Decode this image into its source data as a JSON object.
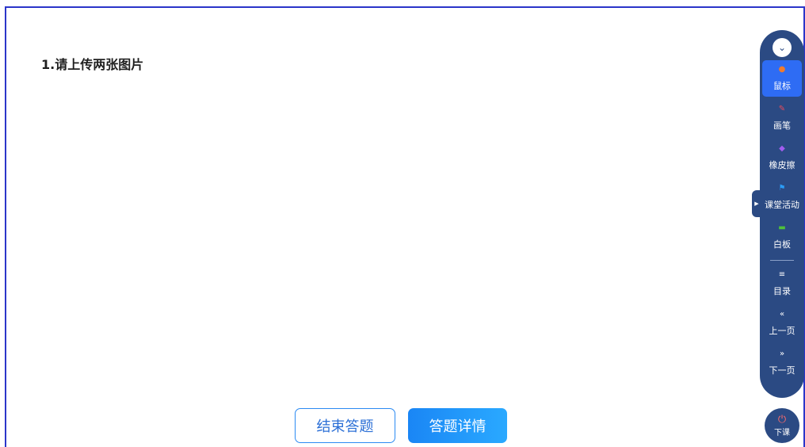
{
  "question": {
    "title": "1.请上传两张图片"
  },
  "buttons": {
    "end_answer": "结束答题",
    "answer_details": "答题详情"
  },
  "toolbar": {
    "collapse_icon": "chevron-down-icon",
    "tools": [
      {
        "label": "鼠标",
        "icon": "mouse-icon",
        "glyph": "●",
        "color": "#f07b2e",
        "active": true
      },
      {
        "label": "画笔",
        "icon": "brush-icon",
        "glyph": "✎",
        "color": "#e84b5a",
        "active": false
      },
      {
        "label": "橡皮擦",
        "icon": "eraser-icon",
        "glyph": "◆",
        "color": "#a25df0",
        "active": false
      },
      {
        "label": "课堂活动",
        "icon": "flag-icon",
        "glyph": "⚑",
        "color": "#2b9bf5",
        "active": false
      },
      {
        "label": "白板",
        "icon": "whiteboard-icon",
        "glyph": "▬",
        "color": "#4fc23a",
        "active": false
      }
    ],
    "nav": [
      {
        "label": "目录",
        "icon": "list-icon",
        "glyph": "≡"
      },
      {
        "label": "上一页",
        "icon": "double-left-icon",
        "glyph": "«"
      },
      {
        "label": "下一页",
        "icon": "double-right-icon",
        "glyph": "»"
      }
    ]
  },
  "end_class": {
    "label": "下课",
    "icon": "power-icon",
    "glyph": "⏻"
  }
}
